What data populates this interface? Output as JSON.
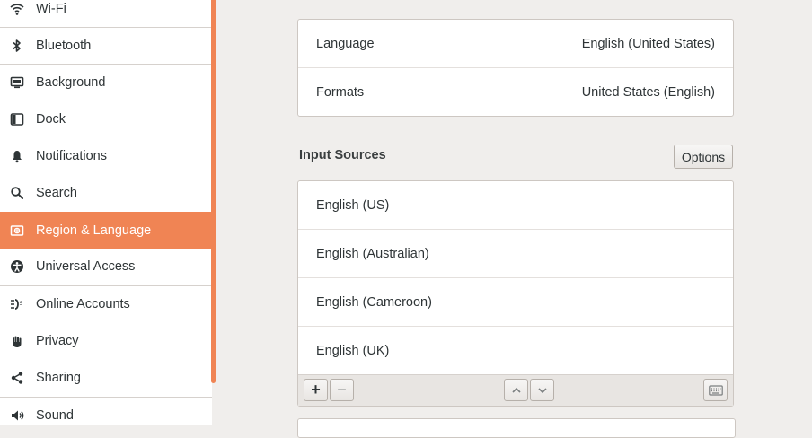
{
  "sidebar": {
    "items": [
      {
        "label": "Wi-Fi",
        "icon": "wifi-icon"
      },
      {
        "label": "Bluetooth",
        "icon": "bluetooth-icon"
      },
      {
        "label": "Background",
        "icon": "background-icon"
      },
      {
        "label": "Dock",
        "icon": "dock-icon"
      },
      {
        "label": "Notifications",
        "icon": "bell-icon"
      },
      {
        "label": "Search",
        "icon": "search-icon"
      },
      {
        "label": "Region & Language",
        "icon": "flag-icon",
        "selected": true
      },
      {
        "label": "Universal Access",
        "icon": "accessibility-icon"
      },
      {
        "label": "Online Accounts",
        "icon": "online-accounts-icon"
      },
      {
        "label": "Privacy",
        "icon": "hand-icon"
      },
      {
        "label": "Sharing",
        "icon": "share-icon"
      },
      {
        "label": "Sound",
        "icon": "speaker-icon"
      }
    ]
  },
  "region": {
    "rows": [
      {
        "label": "Language",
        "value": "English (United States)"
      },
      {
        "label": "Formats",
        "value": "United States (English)"
      }
    ]
  },
  "input_sources": {
    "title": "Input Sources",
    "options_label": "Options",
    "items": [
      "English (US)",
      "English (Australian)",
      "English (Cameroon)",
      "English (UK)"
    ],
    "toolbar": {
      "add_label": "+",
      "remove_label": "−"
    }
  },
  "colors": {
    "accent": "#f08454",
    "background": "#f0eeec"
  }
}
